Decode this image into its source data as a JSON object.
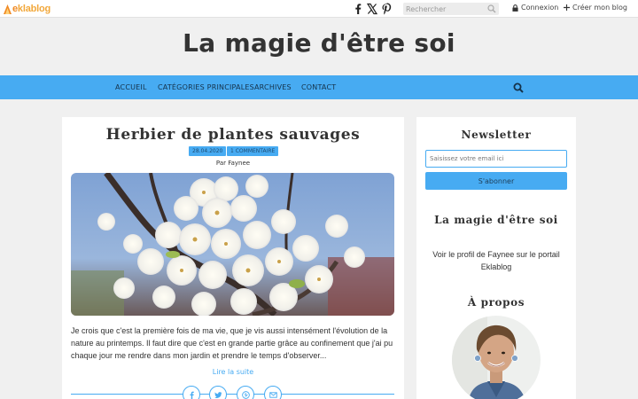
{
  "topbar": {
    "logo_e": "e",
    "logo_rest": "klablog",
    "search_placeholder": "Rechercher",
    "login_label": "Connexion",
    "create_blog_label": "Créer mon blog"
  },
  "header": {
    "title": "La magie d'être soi"
  },
  "nav": {
    "items": [
      "ACCUEIL",
      "CATÉGORIES PRINCIPALES",
      "ARCHIVES",
      "CONTACT"
    ]
  },
  "post": {
    "title": "Herbier de plantes sauvages",
    "date": "28.04.2020",
    "comments": "1 COMMENTAIRE",
    "author": "Par Faynee",
    "excerpt": "Je crois que c'est la première fois de ma vie, que je vis aussi intensément l'évolution de la nature au printemps. Il faut dire que c'est en grande partie grâce au confinement que j'ai pu chaque jour me rendre dans mon jardin et prendre le temps d'observer...",
    "read_more": "Lire la suite"
  },
  "sidebar": {
    "newsletter_title": "Newsletter",
    "email_placeholder": "Saisissez votre email ici",
    "subscribe_label": "S'abonner",
    "blog_title": "La magie d'être soi",
    "profile_link": "Voir le profil de Faynee sur le portail Eklablog",
    "about_title": "À propos"
  },
  "colors": {
    "accent": "#47abf2",
    "logo_orange": "#f2a83b"
  },
  "icons": {
    "topbar": [
      "facebook-icon",
      "x-icon",
      "pinterest-icon",
      "search-icon",
      "lock-icon",
      "plus-icon"
    ],
    "share": [
      "facebook-icon",
      "twitter-icon",
      "pinterest-icon",
      "email-icon"
    ]
  }
}
